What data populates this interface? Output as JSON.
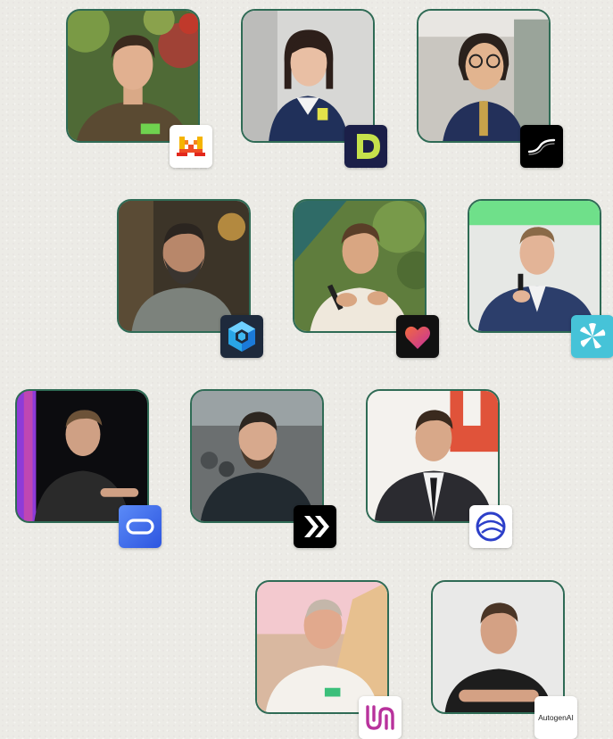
{
  "people": [
    {
      "id": "p1",
      "logo": "mistral-logo",
      "tone": "#6b5440"
    },
    {
      "id": "p2",
      "logo": "d-brand-logo",
      "tone": "#1f2f55"
    },
    {
      "id": "p3",
      "logo": "swirl-logo",
      "tone": "#23305a"
    },
    {
      "id": "p4",
      "logo": "hex-cube-logo",
      "tone": "#7a7f78"
    },
    {
      "id": "p5",
      "logo": "heart-logo",
      "tone": "#efe8dc"
    },
    {
      "id": "p6",
      "logo": "pinwheel-logo",
      "tone": "#2c3e6b"
    },
    {
      "id": "p7",
      "logo": "rounded-rect-logo",
      "tone": "#2a2a2a"
    },
    {
      "id": "p8",
      "logo": "double-chevron-logo",
      "tone": "#222a30"
    },
    {
      "id": "p9",
      "logo": "globe-logo",
      "tone": "#2b2b30"
    },
    {
      "id": "p10",
      "logo": "u-wave-logo",
      "tone": "#f4f1ec"
    },
    {
      "id": "p11",
      "logo": "autogenai-wordmark",
      "tone": "#1d1d1d",
      "logo_text": "AutogenAI"
    }
  ],
  "colors": {
    "frame": "#2f6b55",
    "background": "#ecebe6",
    "mistral_orange": "#f5821f",
    "d_brand_green": "#c6e24b",
    "heart_pink": "#e2439a",
    "pinwheel_teal": "#46c3d8",
    "rounded_blue": "#3a6bf0",
    "globe_blue": "#2c3fc9",
    "u_purple": "#b8329c"
  }
}
